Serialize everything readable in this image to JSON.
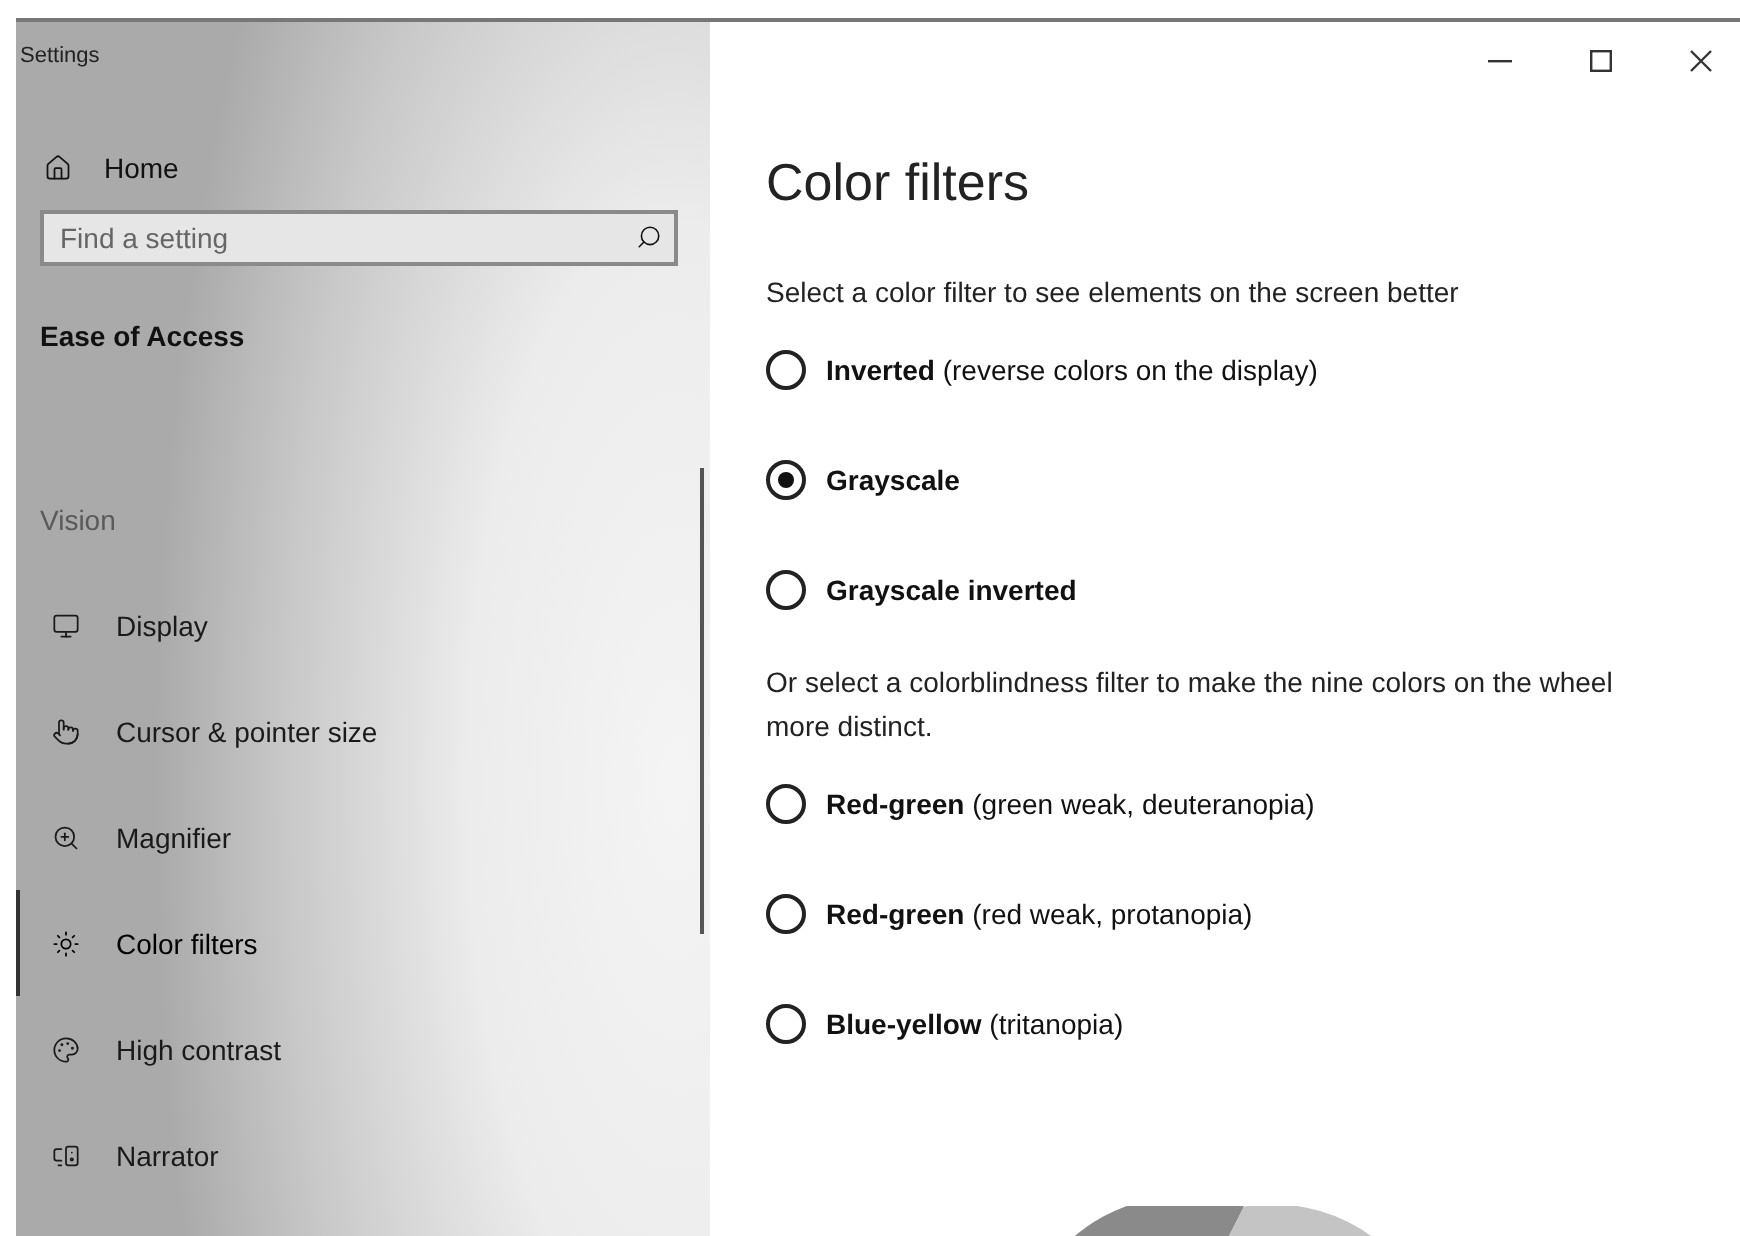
{
  "window": {
    "title": "Settings"
  },
  "sidebar": {
    "home": "Home",
    "search": {
      "placeholder": "Find a setting"
    },
    "section": "Ease of Access",
    "group": "Vision",
    "items": [
      {
        "label": "Display",
        "selected": false
      },
      {
        "label": "Cursor & pointer size",
        "selected": false
      },
      {
        "label": "Magnifier",
        "selected": false
      },
      {
        "label": "Color filters",
        "selected": true
      },
      {
        "label": "High contrast",
        "selected": false
      },
      {
        "label": "Narrator",
        "selected": false
      }
    ]
  },
  "content": {
    "heading": "Color filters",
    "groups": [
      {
        "intro": "Select a color filter to see elements on the screen better",
        "options": [
          {
            "label": "**Inverted** (reverse colors on the display)",
            "selected": false
          },
          {
            "label": "**Grayscale**",
            "selected": true
          },
          {
            "label": "**Grayscale inverted**",
            "selected": false
          }
        ]
      },
      {
        "intro": "Or select a colorblindness filter to make the nine colors on the wheel more distinct.",
        "options": [
          {
            "label": "**Red-green** (green weak, deuteranopia)",
            "selected": false
          },
          {
            "label": "**Red-green** (red weak, protanopia)",
            "selected": false
          },
          {
            "label": "**Blue-yellow** (tritanopia)",
            "selected": false
          }
        ]
      }
    ]
  }
}
